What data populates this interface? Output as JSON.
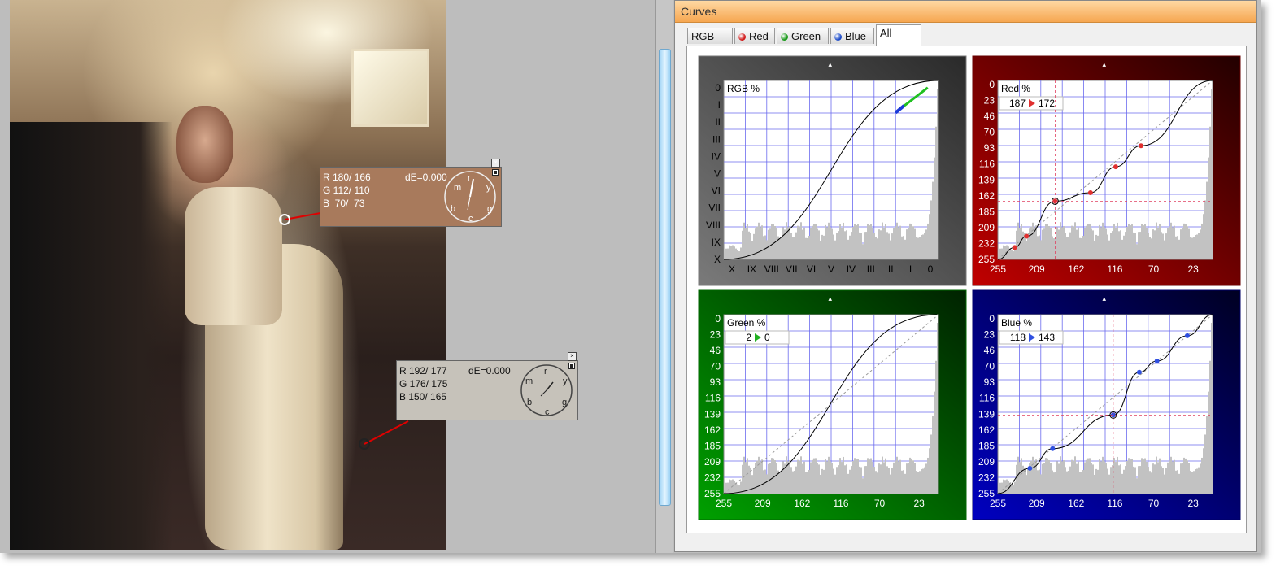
{
  "panel": {
    "title": "Curves"
  },
  "tabs": [
    {
      "label": "RGB",
      "dot": ""
    },
    {
      "label": "Red",
      "dot": "#d11a1a"
    },
    {
      "label": "Green",
      "dot": "#1a9a1a"
    },
    {
      "label": "Blue",
      "dot": "#1a4ac8"
    },
    {
      "label": "All",
      "dot": ""
    }
  ],
  "active_tab": "All",
  "probe1": {
    "r": "R 180/ 166",
    "g": "G 112/ 110",
    "b": "B  70/  73",
    "de": "dE=0.000",
    "color": "#a87a5c",
    "hands": {
      "m": "m",
      "r": "r",
      "y": "y",
      "g": "g",
      "c": "c",
      "b": "b"
    }
  },
  "probe2": {
    "r": "R 192/ 177",
    "g": "G 176/ 175",
    "b": "B 150/ 165",
    "de": "dE=0.000",
    "color": "#c6c2ba",
    "hands": {
      "m": "m",
      "r": "r",
      "y": "y",
      "g": "g",
      "c": "c",
      "b": "b"
    }
  },
  "chart_data": [
    {
      "type": "line",
      "title": "RGB %",
      "x_tick_labels": [
        "X",
        "IX",
        "VIII",
        "VII",
        "VI",
        "V",
        "IV",
        "III",
        "II",
        "I",
        "0"
      ],
      "y_tick_labels": [
        "0",
        "I",
        "II",
        "III",
        "IV",
        "V",
        "VI",
        "VII",
        "VIII",
        "IX",
        "X"
      ],
      "series": [
        {
          "points": [
            [
              0,
              0
            ],
            [
              100,
              100
            ]
          ]
        }
      ]
    },
    {
      "type": "line",
      "title": "Red %",
      "input": "187",
      "output": "172",
      "xlim": [
        255,
        0
      ],
      "ylim": [
        255,
        0
      ],
      "x_tick_labels": [
        "255",
        "209",
        "162",
        "116",
        "70",
        "23"
      ],
      "y_tick_labels": [
        "0",
        "23",
        "46",
        "70",
        "93",
        "116",
        "139",
        "162",
        "185",
        "209",
        "232",
        "255"
      ],
      "series": [
        {
          "points": [
            [
              255,
              255
            ],
            [
              235,
              238
            ],
            [
              221,
              222
            ],
            [
              187,
              172
            ],
            [
              145,
              160
            ],
            [
              115,
              123
            ],
            [
              85,
              93
            ],
            [
              0,
              0
            ]
          ]
        }
      ]
    },
    {
      "type": "line",
      "title": "Green %",
      "input": "2",
      "output": "0",
      "xlim": [
        255,
        0
      ],
      "ylim": [
        255,
        0
      ],
      "x_tick_labels": [
        "255",
        "209",
        "162",
        "116",
        "70",
        "23"
      ],
      "y_tick_labels": [
        "0",
        "23",
        "46",
        "70",
        "93",
        "116",
        "139",
        "162",
        "185",
        "209",
        "232",
        "255"
      ],
      "series": [
        {
          "points": [
            [
              255,
              255
            ],
            [
              2,
              0
            ]
          ]
        }
      ]
    },
    {
      "type": "line",
      "title": "Blue %",
      "input": "118",
      "output": "143",
      "xlim": [
        255,
        0
      ],
      "ylim": [
        255,
        0
      ],
      "x_tick_labels": [
        "255",
        "209",
        "162",
        "116",
        "70",
        "23"
      ],
      "y_tick_labels": [
        "0",
        "23",
        "46",
        "70",
        "93",
        "116",
        "139",
        "162",
        "185",
        "209",
        "232",
        "255"
      ],
      "series": [
        {
          "points": [
            [
              255,
              255
            ],
            [
              217,
              219
            ],
            [
              190,
              191
            ],
            [
              118,
              143
            ],
            [
              87,
              82
            ],
            [
              66,
              66
            ],
            [
              30,
              30
            ],
            [
              0,
              0
            ]
          ]
        }
      ]
    }
  ]
}
